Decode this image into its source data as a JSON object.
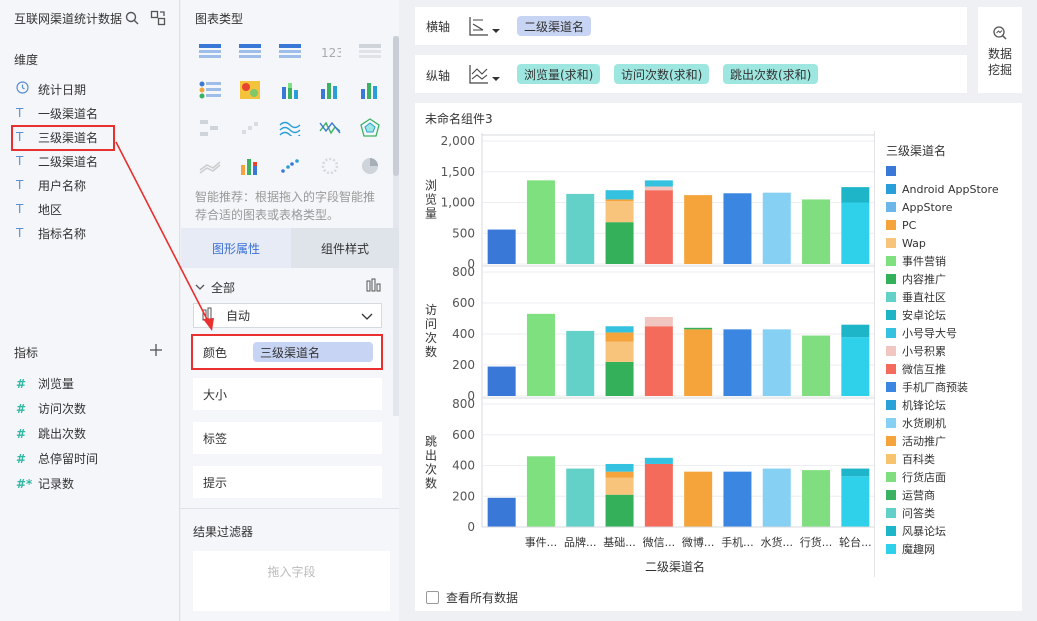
{
  "left": {
    "title": "互联网渠道统计数据",
    "dim_label": "维度",
    "dimensions": [
      {
        "type": "clock",
        "name": "统计日期"
      },
      {
        "type": "T",
        "name": "一级渠道名"
      },
      {
        "type": "T",
        "name": "三级渠道名"
      },
      {
        "type": "T",
        "name": "二级渠道名"
      },
      {
        "type": "T",
        "name": "用户名称"
      },
      {
        "type": "T",
        "name": "地区"
      },
      {
        "type": "T",
        "name": "指标名称"
      }
    ],
    "metric_label": "指标",
    "metrics": [
      {
        "type": "#",
        "name": "浏览量"
      },
      {
        "type": "#",
        "name": "访问次数"
      },
      {
        "type": "#",
        "name": "跳出次数"
      },
      {
        "type": "#",
        "name": "总停留时间"
      },
      {
        "type": "#*",
        "name": "记录数"
      }
    ]
  },
  "mid": {
    "chart_type_label": "图表类型",
    "hint": "智能推荐：根据拖入的字段智能推荐合适的图表或表格类型。",
    "tabs": [
      "图形属性",
      "组件样式"
    ],
    "all_label": "全部",
    "auto_label": "自动",
    "color_label": "颜色",
    "color_field": "三级渠道名",
    "size_label": "大小",
    "tag_label": "标签",
    "tip_label": "提示",
    "filter_label": "结果过滤器",
    "filter_placeholder": "拖入字段"
  },
  "top": {
    "x_label": "横轴",
    "x_field": "二级渠道名",
    "y_label": "纵轴",
    "y_fields": [
      "浏览量(求和)",
      "访问次数(求和)",
      "跳出次数(求和)"
    ],
    "mining_label": "数据挖掘"
  },
  "chart": {
    "title": "未命名组件3",
    "x_title": "二级渠道名",
    "legend_title": "三级渠道名",
    "show_all_label": "查看所有数据",
    "colors": {
      "blank": "#3a78d8",
      "Android AppStore": "#2a9ed8",
      "AppStore": "#6cb6ea",
      "PC": "#f5a43c",
      "Wap": "#f8c37a",
      "事件营销": "#7ee07e",
      "内容推广": "#34b05a",
      "垂直社区": "#63d1c8",
      "安卓论坛": "#1fb3c6",
      "小号导大号": "#34c2e0",
      "小号积累": "#f2c6c0",
      "微信互推": "#f46b5b",
      "手机厂商预装": "#3a86e0",
      "机锋论坛": "#2aa2d8",
      "水货刷机": "#86d0f4",
      "活动推广": "#f5a43c",
      "百科类": "#f8c36d",
      "行货店面": "#80de80",
      "运营商": "#3bb262",
      "问答类": "#62d0c8",
      "风暴论坛": "#1fb5c8",
      "魔趣网": "#2fd0ea"
    }
  },
  "chart_data": {
    "type": "bar",
    "stacked": true,
    "categories": [
      "",
      "事件...",
      "品牌...",
      "基础...",
      "微信...",
      "微博...",
      "手机...",
      "水货...",
      "行货...",
      "轮台..."
    ],
    "legend": [
      "",
      "Android AppStore",
      "AppStore",
      "PC",
      "Wap",
      "事件营销",
      "内容推广",
      "垂直社区",
      "安卓论坛",
      "小号导大号",
      "小号积累",
      "微信互推",
      "手机厂商预装",
      "机锋论坛",
      "水货刷机",
      "活动推广",
      "百科类",
      "行货店面",
      "运营商",
      "问答类",
      "风暴论坛",
      "魔趣网"
    ],
    "panels": [
      {
        "ylabel": "浏览量",
        "ylim": [
          0,
          2000
        ],
        "ticks": [
          "2,000",
          "1,500",
          "1,000",
          "500",
          "0"
        ],
        "bars": [
          [
            {
              "s": "",
              "v": 560
            }
          ],
          [
            {
              "s": "事件营销",
              "v": 1360
            }
          ],
          [
            {
              "s": "垂直社区",
              "v": 1140
            }
          ],
          [
            {
              "s": "内容推广",
              "v": 680
            },
            {
              "s": "Wap",
              "v": 340
            },
            {
              "s": "PC",
              "v": 30
            },
            {
              "s": "小号导大号",
              "v": 150
            }
          ],
          [
            {
              "s": "微信互推",
              "v": 1200
            },
            {
              "s": "小号积累",
              "v": 60
            },
            {
              "s": "小号导大号",
              "v": 100
            }
          ],
          [
            {
              "s": "活动推广",
              "v": 1120
            }
          ],
          [
            {
              "s": "手机厂商预装",
              "v": 1150
            }
          ],
          [
            {
              "s": "水货刷机",
              "v": 1160
            }
          ],
          [
            {
              "s": "行货店面",
              "v": 1050
            }
          ],
          [
            {
              "s": "魔趣网",
              "v": 1000
            },
            {
              "s": "风暴论坛",
              "v": 250
            }
          ]
        ]
      },
      {
        "ylabel": "访问次数",
        "ylim": [
          0,
          800
        ],
        "ticks": [
          "800",
          "600",
          "400",
          "200",
          "0"
        ],
        "bars": [
          [
            {
              "s": "",
              "v": 190
            }
          ],
          [
            {
              "s": "事件营销",
              "v": 530
            }
          ],
          [
            {
              "s": "垂直社区",
              "v": 420
            }
          ],
          [
            {
              "s": "内容推广",
              "v": 220
            },
            {
              "s": "Wap",
              "v": 130
            },
            {
              "s": "PC",
              "v": 60
            },
            {
              "s": "小号导大号",
              "v": 40
            }
          ],
          [
            {
              "s": "微信互推",
              "v": 450
            },
            {
              "s": "小号积累",
              "v": 60
            }
          ],
          [
            {
              "s": "活动推广",
              "v": 430
            },
            {
              "s": "内容推广",
              "v": 10
            }
          ],
          [
            {
              "s": "手机厂商预装",
              "v": 430
            }
          ],
          [
            {
              "s": "水货刷机",
              "v": 430
            }
          ],
          [
            {
              "s": "行货店面",
              "v": 390
            }
          ],
          [
            {
              "s": "魔趣网",
              "v": 380
            },
            {
              "s": "风暴论坛",
              "v": 80
            }
          ]
        ]
      },
      {
        "ylabel": "跳出次数",
        "ylim": [
          0,
          800
        ],
        "ticks": [
          "800",
          "600",
          "400",
          "200",
          "0"
        ],
        "bars": [
          [
            {
              "s": "",
              "v": 190
            }
          ],
          [
            {
              "s": "事件营销",
              "v": 460
            }
          ],
          [
            {
              "s": "垂直社区",
              "v": 380
            }
          ],
          [
            {
              "s": "内容推广",
              "v": 210
            },
            {
              "s": "Wap",
              "v": 110
            },
            {
              "s": "PC",
              "v": 40
            },
            {
              "s": "小号导大号",
              "v": 50
            }
          ],
          [
            {
              "s": "微信互推",
              "v": 410
            },
            {
              "s": "小号导大号",
              "v": 40
            }
          ],
          [
            {
              "s": "活动推广",
              "v": 360
            }
          ],
          [
            {
              "s": "手机厂商预装",
              "v": 360
            }
          ],
          [
            {
              "s": "水货刷机",
              "v": 380
            }
          ],
          [
            {
              "s": "行货店面",
              "v": 370
            }
          ],
          [
            {
              "s": "魔趣网",
              "v": 330
            },
            {
              "s": "风暴论坛",
              "v": 50
            }
          ]
        ]
      }
    ]
  }
}
